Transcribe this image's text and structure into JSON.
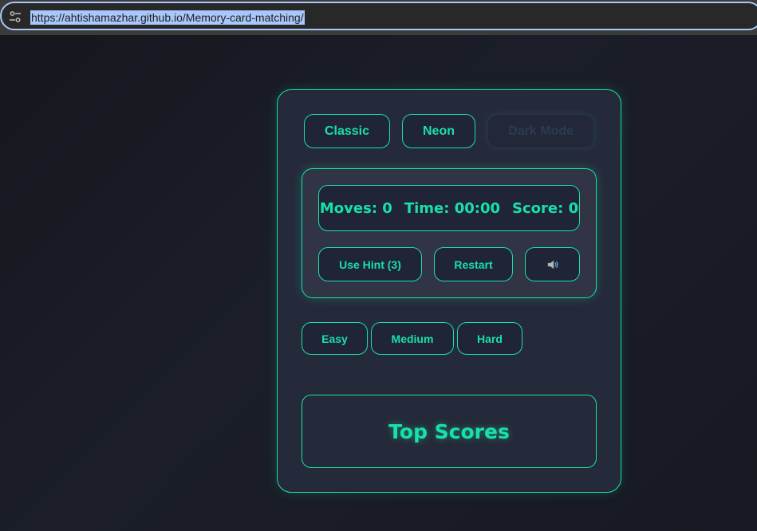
{
  "browser": {
    "url": "https://ahtishamazhar.github.io/Memory-card-matching/",
    "site_info_icon": "tune-icon"
  },
  "themes": {
    "classic_label": "Classic",
    "neon_label": "Neon",
    "dark_mode_label": "Dark Mode"
  },
  "stats": {
    "moves": "Moves: 0",
    "time": "Time: 00:00",
    "score": "Score: 0"
  },
  "actions": {
    "hint_label": "Use Hint (3)",
    "restart_label": "Restart",
    "sound_icon": "speaker-icon"
  },
  "difficulty": {
    "easy_label": "Easy",
    "medium_label": "Medium",
    "hard_label": "Hard"
  },
  "scores": {
    "title": "Top Scores"
  },
  "colors": {
    "accent": "#18e0a8",
    "panel_bg": "#252a3b",
    "page_bg": "#171922"
  }
}
